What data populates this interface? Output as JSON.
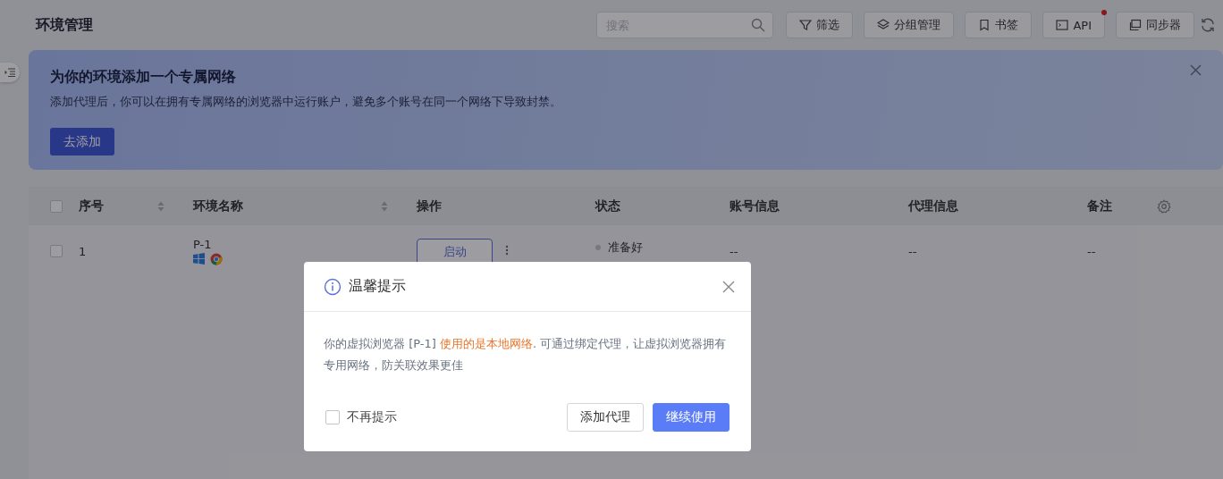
{
  "header": {
    "title": "环境管理",
    "search": {
      "placeholder": "搜索"
    },
    "toolbar": [
      {
        "label": "筛选",
        "kind": "filter",
        "notify": false
      },
      {
        "label": "分组管理",
        "kind": "layers",
        "notify": false
      },
      {
        "label": "书签",
        "kind": "bookmark",
        "notify": false
      },
      {
        "label": "API",
        "kind": "terminal",
        "notify": true
      },
      {
        "label": "同步器",
        "kind": "window",
        "notify": false
      }
    ]
  },
  "banner": {
    "title": "为你的环境添加一个专属网络",
    "text": "添加代理后，你可以在拥有专属网络的浏览器中运行账户，避免多个账号在同一个网络下导致封禁。",
    "button": "去添加"
  },
  "table": {
    "select_all": {
      "checked": false
    },
    "columns": [
      {
        "label": "序号",
        "sortable": true
      },
      {
        "label": "环境名称",
        "sortable": true
      },
      {
        "label": "操作",
        "sortable": false
      },
      {
        "label": "状态",
        "sortable": false
      },
      {
        "label": "账号信息",
        "sortable": false
      },
      {
        "label": "代理信息",
        "sortable": false
      },
      {
        "label": "备注",
        "sortable": false
      }
    ],
    "rows": [
      {
        "checked": false,
        "index": "1",
        "name": "P-1",
        "action": "启动",
        "status": {
          "label": "准备好"
        },
        "account": "--",
        "proxy": "--",
        "note": "--"
      }
    ]
  },
  "dialog": {
    "title": "温馨提示",
    "message": [
      {
        "text": "你的虚拟浏览器 [P-1] ",
        "highlight": false
      },
      {
        "text": "使用的是本地网络",
        "highlight": true
      },
      {
        "text": ". 可通过绑定代理，让虚拟浏览器拥有专用网络，防关联效果更佳",
        "highlight": false
      }
    ],
    "dont_remind": {
      "label": "不再提示",
      "checked": false
    },
    "buttons": [
      {
        "label": "添加代理",
        "primary": false
      },
      {
        "label": "继续使用",
        "primary": true
      }
    ]
  }
}
